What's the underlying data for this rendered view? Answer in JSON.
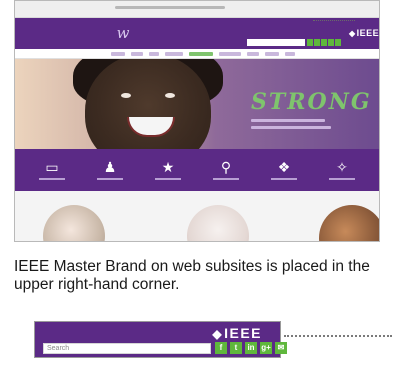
{
  "site": {
    "brand": "IEEE",
    "headline": "STRONG",
    "icons": [
      {
        "name": "badge-icon",
        "glyph": "▭"
      },
      {
        "name": "microphone-icon",
        "glyph": "♟"
      },
      {
        "name": "star-icon",
        "glyph": "★"
      },
      {
        "name": "lightbulb-icon",
        "glyph": "⚲"
      },
      {
        "name": "heart-badge-icon",
        "glyph": "❖"
      },
      {
        "name": "chat-icon",
        "glyph": "✧"
      }
    ]
  },
  "caption": "IEEE Master Brand on web subsites is placed in the upper right-hand corner.",
  "zoom": {
    "brand": "IEEE",
    "search_placeholder": "Search",
    "social": [
      {
        "name": "facebook-icon",
        "glyph": "f"
      },
      {
        "name": "twitter-icon",
        "glyph": "t"
      },
      {
        "name": "linkedin-icon",
        "glyph": "in"
      },
      {
        "name": "googleplus-icon",
        "glyph": "g+"
      },
      {
        "name": "email-icon",
        "glyph": "✉"
      }
    ]
  },
  "colors": {
    "brand_purple": "#5b2a86",
    "social_green": "#5fb73c",
    "headline_green": "#7fc46d"
  }
}
